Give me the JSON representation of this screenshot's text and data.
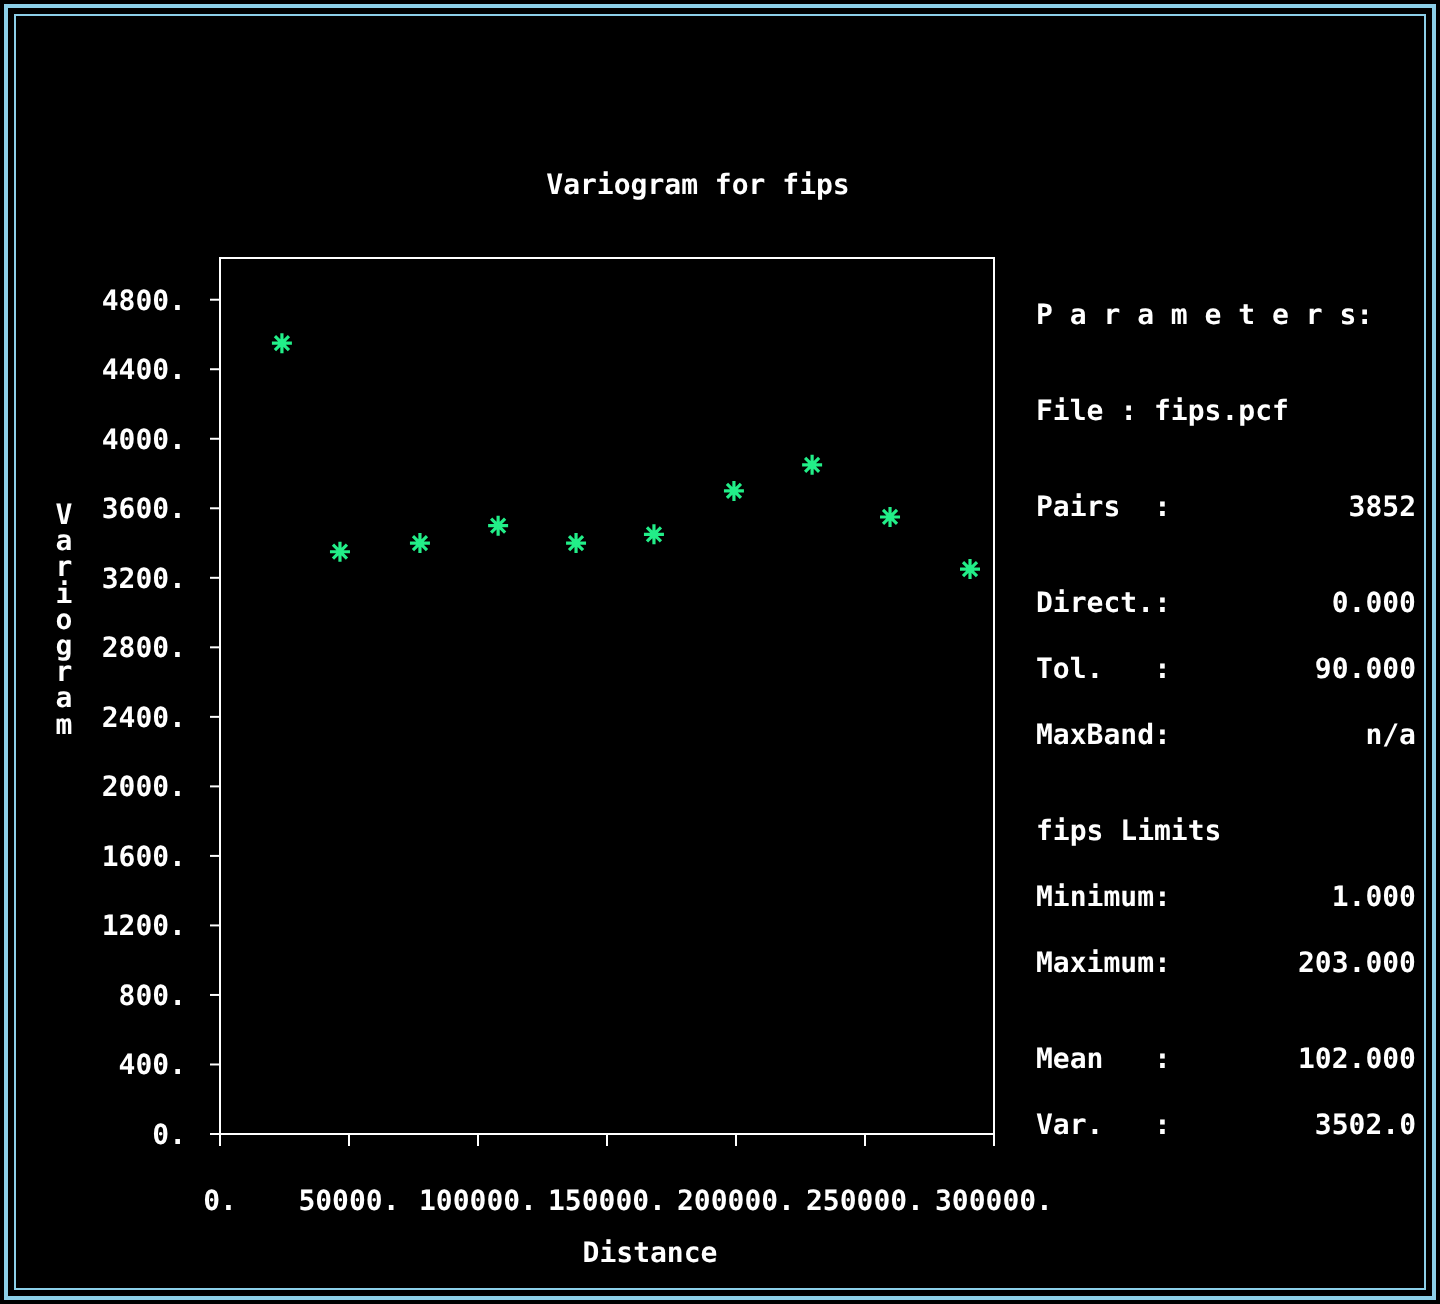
{
  "chart_data": {
    "type": "scatter",
    "title": "Variogram for fips",
    "xlabel": "Distance",
    "ylabel": "Variogram",
    "x": [
      24000,
      46500,
      77500,
      107800,
      138000,
      168200,
      199200,
      229500,
      259700,
      290700
    ],
    "series": [
      {
        "color": "#22ee88",
        "values": [
          4550,
          3350,
          3400,
          3500,
          3400,
          3450,
          3700,
          3850,
          3550,
          3250
        ]
      }
    ],
    "xlim": [
      0,
      300000
    ],
    "ylim": [
      0,
      5040
    ],
    "xticks": [
      {
        "value": 0,
        "label": "0."
      },
      {
        "value": 50000,
        "label": "50000."
      },
      {
        "value": 100000,
        "label": "100000."
      },
      {
        "value": 150000,
        "label": "150000."
      },
      {
        "value": 200000,
        "label": "200000."
      },
      {
        "value": 250000,
        "label": "250000."
      },
      {
        "value": 300000,
        "label": "300000."
      }
    ],
    "yticks": [
      {
        "value": 0,
        "label": "0."
      },
      {
        "value": 400,
        "label": "400."
      },
      {
        "value": 800,
        "label": "800."
      },
      {
        "value": 1200,
        "label": "1200."
      },
      {
        "value": 1600,
        "label": "1600."
      },
      {
        "value": 2000,
        "label": "2000."
      },
      {
        "value": 2400,
        "label": "2400."
      },
      {
        "value": 2800,
        "label": "2800."
      },
      {
        "value": 3200,
        "label": "3200."
      },
      {
        "value": 3600,
        "label": "3600."
      },
      {
        "value": 4000,
        "label": "4000."
      },
      {
        "value": 4400,
        "label": "4400."
      },
      {
        "value": 4800,
        "label": "4800."
      }
    ]
  },
  "parameters": {
    "sections": [
      [
        {
          "kind": "text",
          "text": "P a r a m e t e r s:"
        }
      ],
      [
        {
          "kind": "text",
          "text": "File : fips.pcf"
        }
      ],
      [
        {
          "kind": "pair",
          "label": "Pairs  :",
          "value": "3852"
        }
      ],
      [
        {
          "kind": "pair",
          "label": "Direct.:",
          "value": "0.000"
        },
        {
          "kind": "pair",
          "label": "Tol.   :",
          "value": "90.000"
        },
        {
          "kind": "pair",
          "label": "MaxBand:",
          "value": "n/a"
        }
      ],
      [
        {
          "kind": "text",
          "text": "fips Limits"
        },
        {
          "kind": "pair",
          "label": "Minimum:",
          "value": "1.000"
        },
        {
          "kind": "pair",
          "label": "Maximum:",
          "value": "203.000"
        }
      ],
      [
        {
          "kind": "pair",
          "label": "Mean   :",
          "value": "102.000"
        },
        {
          "kind": "pair",
          "label": "Var.   :",
          "value": "3502.0"
        }
      ]
    ]
  }
}
